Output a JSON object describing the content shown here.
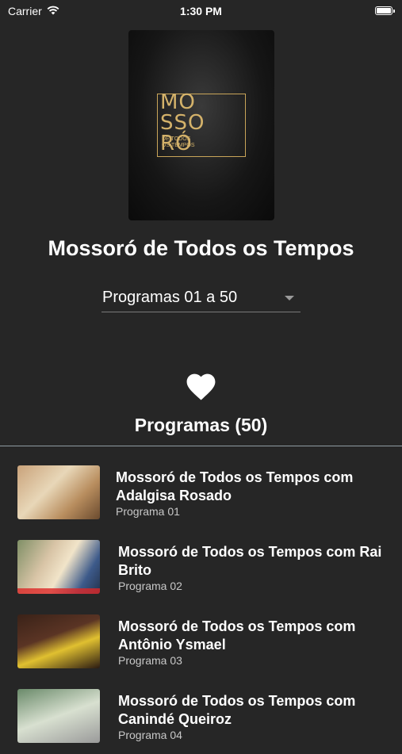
{
  "status_bar": {
    "carrier": "Carrier",
    "time": "1:30 PM",
    "battery_level": 1.0
  },
  "show": {
    "cover_logo_text": "MOSSORÓ",
    "cover_logo_subtitle": "DE TODOS OS TEMPOS",
    "title": "Mossoró de Todos os Tempos"
  },
  "range_selector": {
    "value": "Programas 01 a 50"
  },
  "favorite": {
    "icon": "heart-icon"
  },
  "section": {
    "title": "Programas (50)"
  },
  "episodes": [
    {
      "title": "Mossoró de Todos os Tempos com Adalgisa Rosado",
      "subtitle": "Programa 01"
    },
    {
      "title": "Mossoró de Todos os Tempos com Rai Brito",
      "subtitle": "Programa 02"
    },
    {
      "title": "Mossoró de Todos os Tempos com Antônio Ysmael",
      "subtitle": "Programa 03"
    },
    {
      "title": "Mossoró de Todos os Tempos com Canindé Queiroz",
      "subtitle": "Programa 04"
    }
  ],
  "colors": {
    "background": "#262626",
    "text": "#ffffff",
    "subtext": "#c8c8c8",
    "logo_gold": "#d4b26a",
    "divider": "#8f9ba3"
  }
}
